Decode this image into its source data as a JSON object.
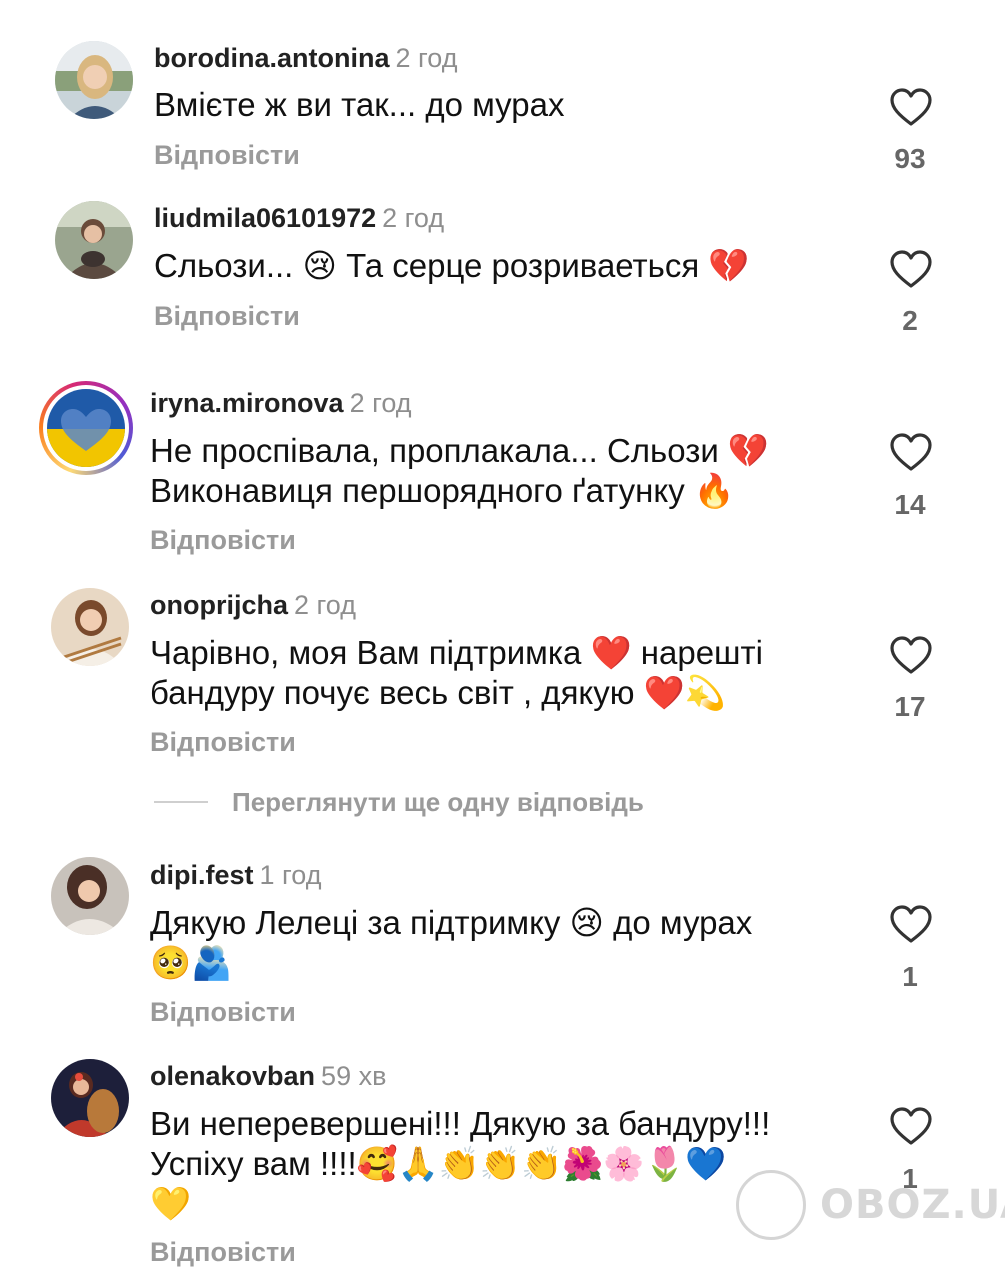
{
  "comments": [
    {
      "username": "borodina.antonina",
      "time": "2 год",
      "text_lines": [
        "Вмієте ж ви так... до мурах"
      ],
      "reply": "Відповісти",
      "likes": "93"
    },
    {
      "username": "liudmila06101972",
      "time": "2 год",
      "text_lines": [
        "Сльози... 😢 Та серце розриваеться 💔"
      ],
      "reply": "Відповісти",
      "likes": "2"
    },
    {
      "username": "iryna.mironova",
      "time": "2 год",
      "text_lines": [
        "Не проспівала, проплакала... Сльози 💔",
        "Виконавиця першорядного ґатунку 🔥"
      ],
      "reply": "Відповісти",
      "likes": "14"
    },
    {
      "username": "onoprijcha",
      "time": "2 год",
      "text_lines": [
        "Чарівно, моя Вам підтримка ❤️ нарешті",
        "бандуру почує весь світ , дякую ❤️💫"
      ],
      "reply": "Відповісти",
      "likes": "17"
    },
    {
      "username": "dipi.fest",
      "time": "1 год",
      "text_lines": [
        "Дякую Лелеці за підтримку 😢 до мурах",
        "🥺🫂"
      ],
      "reply": "Відповісти",
      "likes": "1"
    },
    {
      "username": "olenakovban",
      "time": "59 хв",
      "text_lines": [
        "Ви неперевершені!!! Дякую за бандуру!!!",
        "Успіху вам !!!!🥰🙏👏👏👏🌺🌸🌷💙",
        "💛"
      ],
      "reply": "Відповісти",
      "likes": "1"
    }
  ],
  "more_replies": "Переглянути ще одну відповідь",
  "watermark": "OBOZ.UA",
  "icons": {
    "like": "heart-outline-icon"
  },
  "colors": {
    "username": "#222222",
    "time": "#8e8e8e",
    "reply": "#9a9a9a",
    "like_count": "#666666"
  }
}
